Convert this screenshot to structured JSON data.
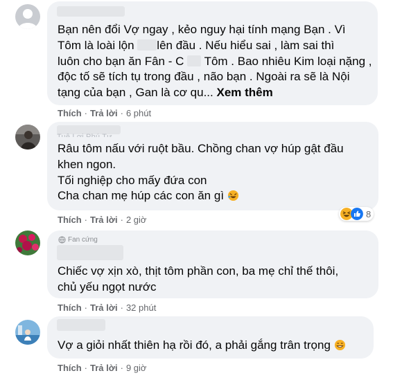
{
  "comments": [
    {
      "lines": [
        "Bạn nên đổi Vợ ngay , kẻo nguy hại tính mạng Bạn . Vì",
        "Tôm là loài lộn",
        "lên đầu . Nếu hiểu sai , làm sai thì",
        "luôn cho bạn ăn Fân - C",
        "Tôm . Bao nhiêu Kim loại nặng ,",
        "độc tố sẽ tích tụ trong đầu , não bạn . Ngoài ra sẽ là Nội",
        "tạng của bạn , Gan là cơ qu..."
      ],
      "see_more": "Xem thêm",
      "like": "Thích",
      "reply": "Trả lời",
      "time": "6 phút"
    },
    {
      "faded_name": "Tuệ Lợi Phú Tư",
      "lines": [
        "Râu tôm nấu với ruột bầu. Chồng chan vợ húp gật đầu",
        "khen ngon.",
        "Tối nghiệp cho mấy đứa con",
        "Cha chan mẹ húp các con ăn gì"
      ],
      "like": "Thích",
      "reply": "Trả lời",
      "time": "2 giờ",
      "reaction_count": "8"
    },
    {
      "badge": "Fan cứng",
      "lines": [
        "Chiếc vợ xịn xò, thịt tôm phần con, ba mẹ chỉ thế thôi,",
        "chủ yếu ngọt nước"
      ],
      "like": "Thích",
      "reply": "Trả lời",
      "time": "32 phút"
    },
    {
      "lines": [
        "Vợ a giỏi nhất thiên hạ rồi đó, a phải gắng trân trọng"
      ],
      "like": "Thích",
      "reply": "Trả lời",
      "time": "9 giờ"
    }
  ],
  "colors": {
    "bubble": "#f0f2f5",
    "text": "#050505",
    "meta": "#65676b",
    "like_blue": "#1877f2",
    "haha_yellow": "#f7b125"
  }
}
